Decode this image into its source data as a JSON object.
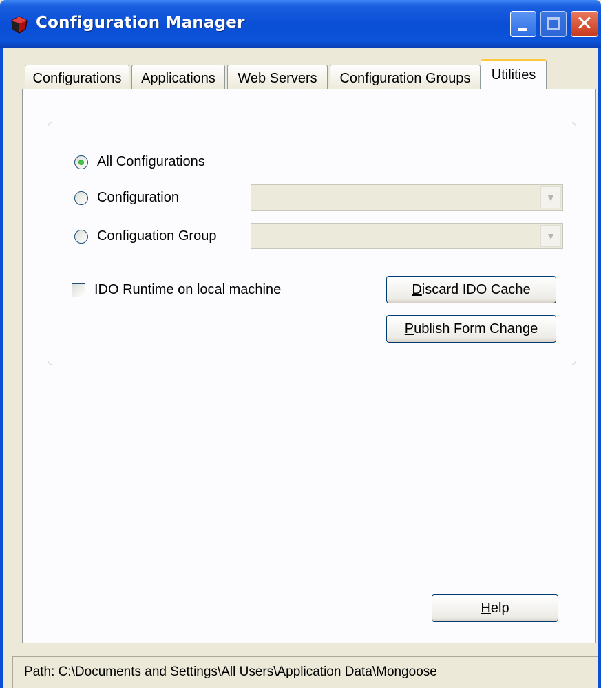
{
  "window": {
    "title": "Configuration Manager",
    "accent_color": "#0a4fd6"
  },
  "tabs": [
    {
      "label": "Configurations"
    },
    {
      "label": "Applications"
    },
    {
      "label": "Web Servers"
    },
    {
      "label": "Configuration Groups"
    },
    {
      "label": "Utilities",
      "active": true
    }
  ],
  "utilities": {
    "scope": {
      "all_configurations": {
        "label": "All Configurations",
        "checked": true
      },
      "configuration": {
        "label": "Configuration",
        "checked": false,
        "value": ""
      },
      "configuration_group": {
        "label": "Configuation Group",
        "checked": false,
        "value": ""
      }
    },
    "ido_runtime": {
      "label": "IDO Runtime on local machine",
      "checked": false
    },
    "discard_button": {
      "mnemonic": "D",
      "rest": "iscard IDO Cache"
    },
    "publish_button": {
      "mnemonic": "P",
      "rest": "ublish  Form Change"
    }
  },
  "help_button": {
    "mnemonic": "H",
    "rest": "elp"
  },
  "status": {
    "path": "Path:  C:\\Documents and Settings\\All Users\\Application Data\\Mongoose"
  }
}
